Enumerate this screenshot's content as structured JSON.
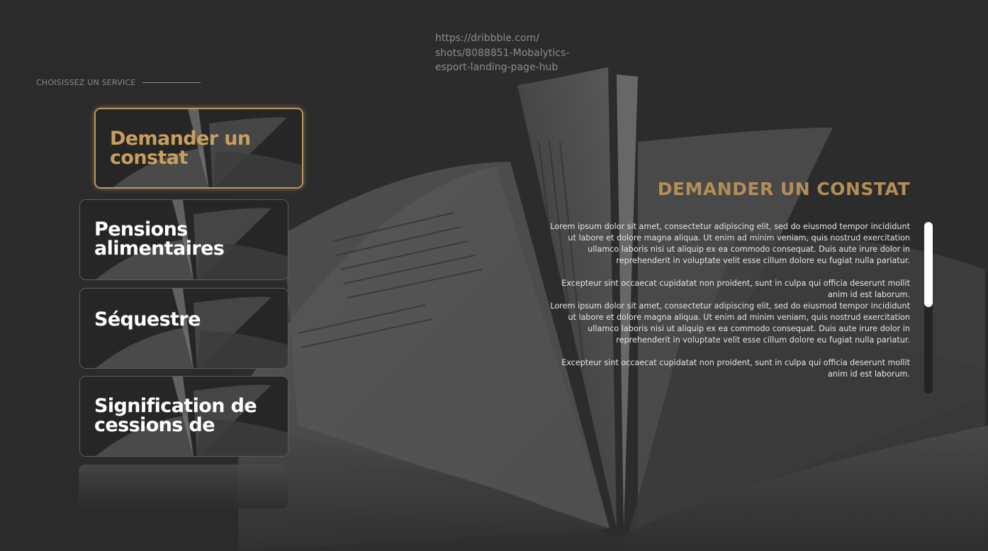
{
  "reference_url": "https://dribbble.com/ shots/8088851-Mobalytics- esport-landing-page-hub",
  "section_label": "CHOISISSEZ UN SERVICE",
  "services": [
    {
      "label": "Demander un constat",
      "active": true
    },
    {
      "label": "Pensions alimentaires",
      "active": false
    },
    {
      "label": "Séquestre",
      "active": false
    },
    {
      "label": "Signification de cessions de",
      "active": false
    }
  ],
  "detail": {
    "title": "DEMANDER UN CONSTAT",
    "paragraphs": [
      "Lorem ipsum dolor sit amet, consectetur adipiscing elit, sed do eiusmod tempor incididunt ut labore et dolore magna aliqua. Ut enim ad minim veniam, quis nostrud exercitation ullamco laboris nisi ut aliquip ex ea commodo consequat. Duis aute irure dolor in reprehenderit in voluptate velit esse cillum dolore eu fugiat nulla pariatur.",
      "Excepteur sint occaecat cupidatat non proident, sunt in culpa qui officia deserunt mollit anim id est laborum.",
      "Lorem ipsum dolor sit amet, consectetur adipiscing elit, sed do eiusmod tempor incididunt ut labore et dolore magna aliqua. Ut enim ad minim veniam, quis nostrud exercitation ullamco laboris nisi ut aliquip ex ea commodo consequat. Duis aute irure dolor in reprehenderit in voluptate velit esse cillum dolore eu fugiat nulla pariatur.",
      "Excepteur sint occaecat cupidatat non proident, sunt in culpa qui officia deserunt mollit anim id est laborum."
    ]
  },
  "colors": {
    "background": "#2c2c2c",
    "accent_gold": "#b9975f",
    "title_gold": "#b38e57",
    "text_light": "#e6e6e6"
  },
  "icons": [
    "open-book-background",
    "scrollbar-thumb"
  ]
}
